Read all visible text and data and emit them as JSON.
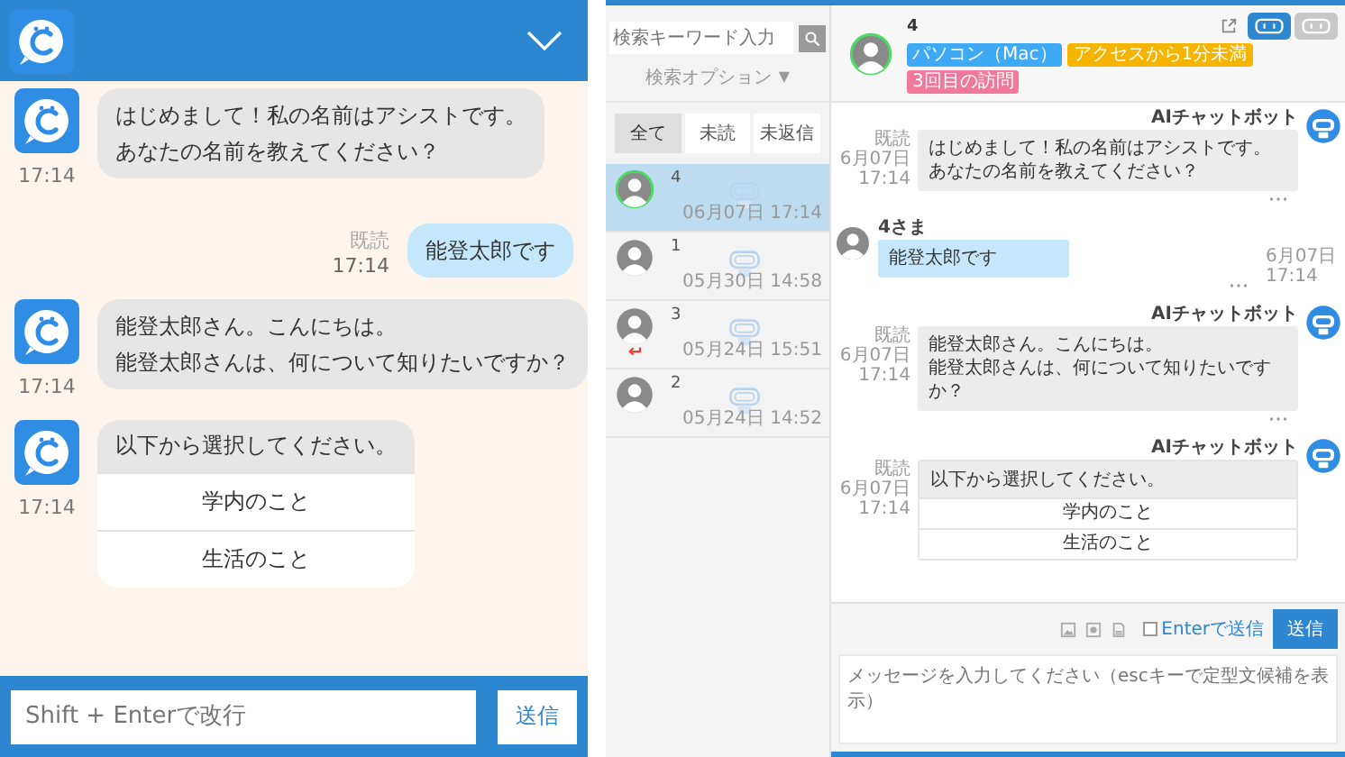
{
  "widget": {
    "messages": [
      {
        "kind": "bot",
        "lines": [
          "はじめまして！私の名前はアシストです。",
          "あなたの名前を教えてください？"
        ],
        "time": "17:14"
      },
      {
        "kind": "user",
        "lines": [
          "能登太郎です"
        ],
        "status": "既読",
        "time": "17:14"
      },
      {
        "kind": "bot",
        "lines": [
          "能登太郎さん。こんにちは。",
          "能登太郎さんは、何について知りたいですか？"
        ],
        "time": "17:14"
      },
      {
        "kind": "choices",
        "text": "以下から選択してください。",
        "options": [
          "学内のこと",
          "生活のこと"
        ],
        "time": "17:14"
      }
    ],
    "input": {
      "placeholder": "Shift + Enterで改行"
    },
    "send_button": "送信"
  },
  "console": {
    "search": {
      "placeholder": "検索キーワード入力"
    },
    "search_options": {
      "label": "検索オプション",
      "caret": "▼"
    },
    "filter_tabs": [
      {
        "label": "全て",
        "selected": true
      },
      {
        "label": "未読",
        "selected": false
      },
      {
        "label": "未返信",
        "selected": false
      }
    ],
    "conversations": [
      {
        "name": "4",
        "time": "06月07日 17:14",
        "selected": true,
        "reply_mark": false
      },
      {
        "name": "1",
        "time": "05月30日 14:58",
        "selected": false,
        "reply_mark": false
      },
      {
        "name": "3",
        "time": "05月24日 15:51",
        "selected": false,
        "reply_mark": true
      },
      {
        "name": "2",
        "time": "05月24日 14:52",
        "selected": false,
        "reply_mark": false
      }
    ],
    "header": {
      "name": "4",
      "tags": [
        {
          "label": "パソコン（Mac）",
          "color": "#3fa9f5"
        },
        {
          "label": "アクセスから1分未満",
          "color": "#f5b400"
        },
        {
          "label": "3回目の訪問",
          "color": "#f0789a"
        }
      ],
      "mode_buttons": [
        {
          "selected": true
        },
        {
          "selected": false
        }
      ]
    },
    "messages": [
      {
        "kind": "bot",
        "sender": "AIチャットボット",
        "status": "既読",
        "date": "6月07日",
        "time": "17:14",
        "lines": [
          "はじめまして！私の名前はアシストです。",
          "あなたの名前を教えてください？"
        ]
      },
      {
        "kind": "user",
        "sender": "4さま",
        "date": "6月07日",
        "time": "17:14",
        "lines": [
          "能登太郎です"
        ]
      },
      {
        "kind": "bot",
        "sender": "AIチャットボット",
        "status": "既読",
        "date": "6月07日",
        "time": "17:14",
        "lines": [
          "能登太郎さん。こんにちは。",
          "能登太郎さんは、何について知りたいです",
          "か？"
        ]
      },
      {
        "kind": "choices",
        "sender": "AIチャットボット",
        "status": "既読",
        "date": "6月07日",
        "time": "17:14",
        "text": "以下から選択してください。",
        "options": [
          "学内のこと",
          "生活のこと"
        ]
      }
    ],
    "compose": {
      "enter_to_send": {
        "label": "Enterで送信",
        "checked": false
      },
      "send_button": "送信",
      "placeholder": "メッセージを入力してください（escキーで定型文候補を表示）"
    }
  }
}
